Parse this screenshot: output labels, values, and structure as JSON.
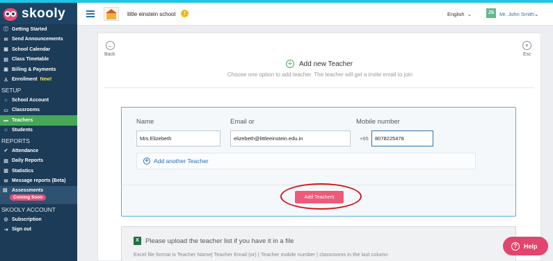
{
  "brand": {
    "name": "skooly"
  },
  "sidebar": {
    "items_top": [
      {
        "label": "Getting Started",
        "icon": "info-icon",
        "glyph": "ⓘ"
      },
      {
        "label": "Send Announcements",
        "icon": "megaphone-icon",
        "glyph": "✉"
      },
      {
        "label": "School Calendar",
        "icon": "calendar-icon",
        "glyph": "▦"
      },
      {
        "label": "Class Timetable",
        "icon": "timetable-icon",
        "glyph": "▤"
      },
      {
        "label": "Billing & Payments",
        "icon": "billing-icon",
        "glyph": "▣"
      },
      {
        "label": "Enrollment",
        "icon": "person-icon",
        "glyph": "♙",
        "badge": "New!"
      }
    ],
    "setup_heading": "SETUP",
    "items_setup": [
      {
        "label": "School Account",
        "icon": "school-icon",
        "glyph": "⌂"
      },
      {
        "label": "Classrooms",
        "icon": "classroom-icon",
        "glyph": "▭"
      },
      {
        "label": "Teachers",
        "icon": "teacher-icon",
        "glyph": "▬",
        "active": true
      },
      {
        "label": "Students",
        "icon": "student-icon",
        "glyph": "☺"
      }
    ],
    "reports_heading": "REPORTS",
    "items_reports": [
      {
        "label": "Attendance",
        "icon": "attendance-icon",
        "glyph": "✔"
      },
      {
        "label": "Daily Reports",
        "icon": "daily-report-icon",
        "glyph": "▤"
      },
      {
        "label": "Statistics",
        "icon": "statistics-icon",
        "glyph": "▥"
      },
      {
        "label": "Message reports (Beta)",
        "icon": "message-report-icon",
        "glyph": "✉"
      }
    ],
    "assessments": {
      "label": "Assessments",
      "badge": "Coming Soon"
    },
    "account_heading": "SKOOLY ACCOUNT",
    "items_account": [
      {
        "label": "Subscription",
        "icon": "subscription-icon",
        "glyph": "◎"
      },
      {
        "label": "Sign out",
        "icon": "signout-icon",
        "glyph": "⇥"
      }
    ]
  },
  "topbar": {
    "school_name": "little einstein school",
    "school_badge": "!",
    "language": "English",
    "avatar_initials": "JS",
    "user_name": "Mr. John Smith"
  },
  "page": {
    "back_label": "Back",
    "esc_label": "Esc",
    "title": "Add new Teacher",
    "subtitle": "Choose one option to add teacher. The teacher will get a invite email to join"
  },
  "form": {
    "name_label": "Name",
    "email_label": "Email or",
    "mobile_label": "Mobile number",
    "name_value": "Mrs.Elizebeth",
    "email_value": "elizebeth@littleeinstein.edu.in",
    "country_code": "+65",
    "mobile_value": "8078225478",
    "add_another_label": "Add another Teacher",
    "submit_label": "Add Teachers"
  },
  "upload": {
    "title": "Please upload the teacher list if you have it in a file",
    "hint": "Excel file format is Teacher Name| Teacher Email (or) | Teacher mobile number | classrooms in the last column"
  },
  "help": {
    "label": "Help"
  },
  "colors": {
    "sidebar_bg": "#1b3b57",
    "active_item": "#46a758",
    "accent_pink": "#ee5a79",
    "link_blue": "#2a6fb0",
    "highlight_ring": "#d3131d"
  }
}
